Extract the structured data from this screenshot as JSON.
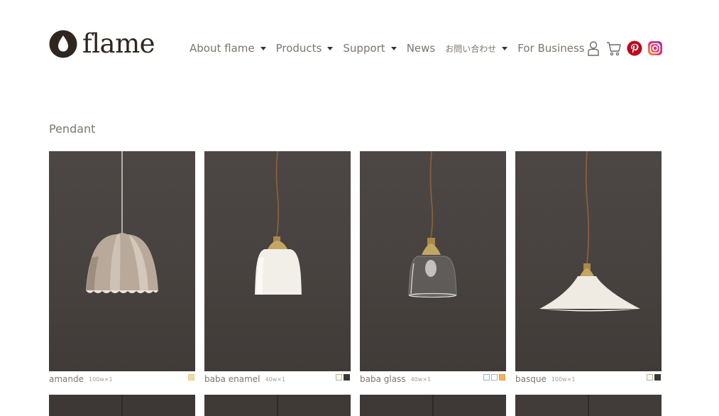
{
  "brand": {
    "name": "flame"
  },
  "nav": {
    "items": [
      {
        "label": "About flame",
        "dropdown": true
      },
      {
        "label": "Products",
        "dropdown": true
      },
      {
        "label": "Support",
        "dropdown": true
      },
      {
        "label": "News",
        "dropdown": false
      },
      {
        "label": "お問い合わせ",
        "dropdown": true
      },
      {
        "label": "For Business",
        "dropdown": false
      }
    ],
    "icons": [
      "user-icon",
      "cart-icon",
      "pinterest-icon",
      "instagram-icon"
    ]
  },
  "section": {
    "title": "Pendant"
  },
  "products": [
    {
      "name": "amande",
      "watt": "100w×1",
      "swatches": [
        {
          "color": "#f3d9a8",
          "border": "#e8c98f"
        }
      ]
    },
    {
      "name": "baba enamel",
      "watt": "40w×1",
      "swatches": [
        {
          "color": "#fbf8ea",
          "border": "#b9b39a"
        },
        {
          "color": "#3a3736",
          "border": "#3a3736"
        }
      ]
    },
    {
      "name": "baba glass",
      "watt": "40w×1",
      "swatches": [
        {
          "color": "#ffffff",
          "border": "#8fb6c9"
        },
        {
          "color": "#ffffff",
          "border": "#a9b4ba"
        },
        {
          "color": "#f2b25f",
          "border": "#e3a04d"
        }
      ]
    },
    {
      "name": "basque",
      "watt": "100w×1",
      "swatches": [
        {
          "color": "#fbf8ea",
          "border": "#b9b39a"
        },
        {
          "color": "#3a3736",
          "border": "#3a3736"
        }
      ]
    }
  ],
  "colors": {
    "nav_text": "#7d7570",
    "logo_text": "#2f2621",
    "photo_bg": "#4a4542",
    "pinterest": "#bd081c",
    "instagram": "#e1306c"
  }
}
